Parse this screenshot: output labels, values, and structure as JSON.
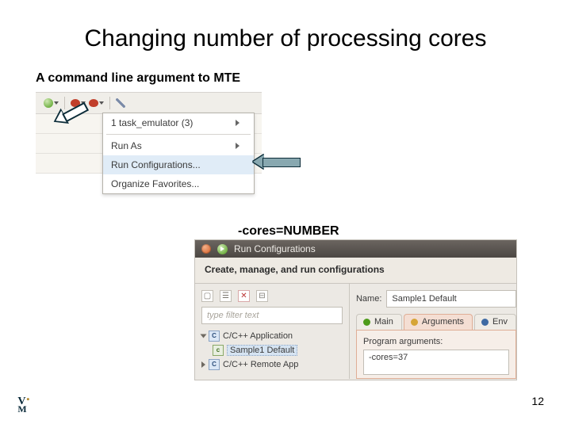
{
  "title": "Changing number of processing cores",
  "subtitle": "A command line argument to MTE",
  "cores_label": "-cores=NUMBER",
  "page_number": "12",
  "context_menu": {
    "item_task_emulator": "1 task_emulator (3)",
    "item_run_as": "Run As",
    "item_run_config": "Run Configurations...",
    "item_organize": "Organize Favorites..."
  },
  "dialog": {
    "window_title": "Run Configurations",
    "header": "Create, manage, and run configurations",
    "filter_placeholder": "type filter text",
    "tree_root": "C/C++ Application",
    "tree_selected": "Sample1 Default",
    "tree_remote": "C/C++ Remote App",
    "name_label": "Name:",
    "name_value": "Sample1 Default",
    "tab_main": "Main",
    "tab_arguments": "Arguments",
    "tab_env": "Env",
    "args_label": "Program arguments:",
    "args_value": "-cores=37"
  }
}
